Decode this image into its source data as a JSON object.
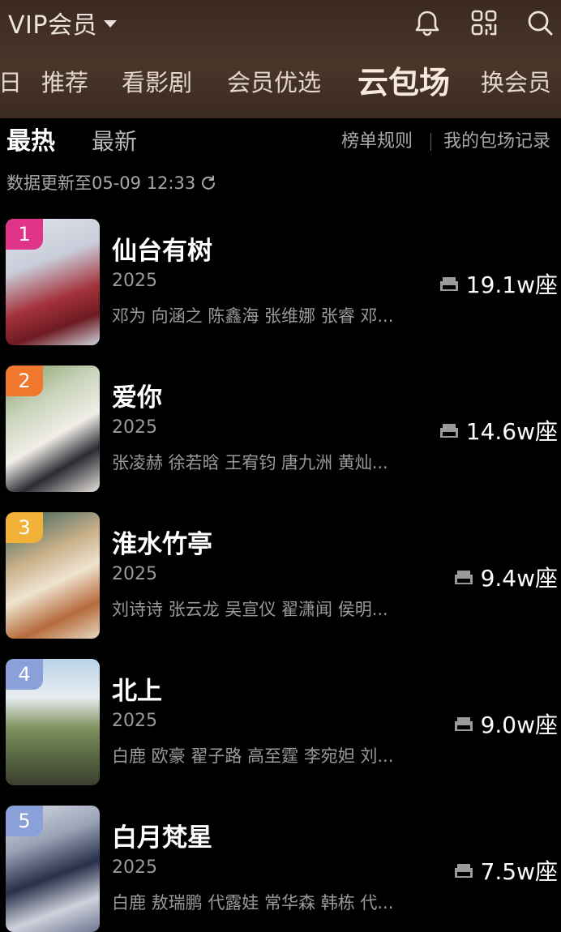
{
  "header": {
    "vip_label": "VIP会员",
    "tabs": [
      {
        "label": "日",
        "active": false
      },
      {
        "label": "推荐",
        "active": false
      },
      {
        "label": "看影剧",
        "active": false
      },
      {
        "label": "会员优选",
        "active": false
      },
      {
        "label": "云包场",
        "active": true
      },
      {
        "label": "换会员",
        "active": false
      }
    ],
    "icons": [
      "bell-icon",
      "scan-icon",
      "search-icon"
    ]
  },
  "subtabs": {
    "hot": "最热",
    "new": "最新",
    "rules": "榜单规则",
    "separator": "|",
    "records": "我的包场记录"
  },
  "update_text": "数据更新至05-09 12:33",
  "items": [
    {
      "rank": "1",
      "rank_color": "#e0338a",
      "title": "仙台有树",
      "year": "2025",
      "cast": "邓为 向涵之 陈鑫海 张维娜 张睿 邓...",
      "seats": "19.1w座"
    },
    {
      "rank": "2",
      "rank_color": "#f0772e",
      "title": "爱你",
      "year": "2025",
      "cast": "张凌赫 徐若晗 王宥钧 唐九洲 黄灿...",
      "seats": "14.6w座"
    },
    {
      "rank": "3",
      "rank_color": "#f2b23a",
      "title": "淮水竹亭",
      "year": "2025",
      "cast": "刘诗诗 张云龙 吴宣仪 翟潇闻 侯明...",
      "seats": "9.4w座"
    },
    {
      "rank": "4",
      "rank_color": "#8aa0d8",
      "title": "北上",
      "year": "2025",
      "cast": "白鹿 欧豪 翟子路 高至霆 李宛妲 刘...",
      "seats": "9.0w座"
    },
    {
      "rank": "5",
      "rank_color": "#8aa0d8",
      "title": "白月梵星",
      "year": "2025",
      "cast": "白鹿 敖瑞鹏 代露娃 常华森 韩栋 代...",
      "seats": "7.5w座"
    }
  ]
}
